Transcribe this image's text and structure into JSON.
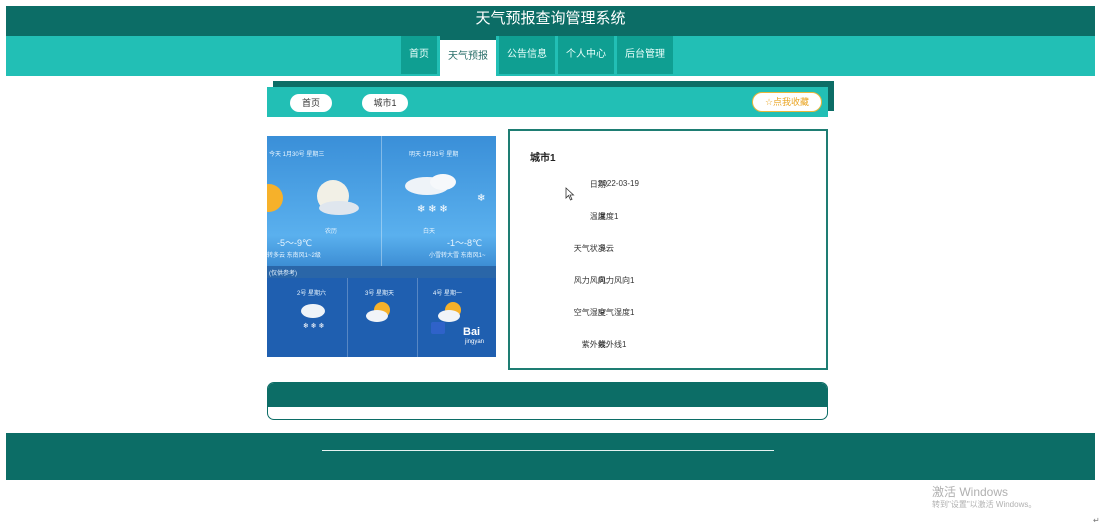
{
  "header": {
    "title": "天气预报查询管理系统",
    "nav": [
      {
        "label": "首页",
        "active": false
      },
      {
        "label": "天气预报",
        "active": true
      },
      {
        "label": "公告信息",
        "active": false
      },
      {
        "label": "个人中心",
        "active": false
      },
      {
        "label": "后台管理",
        "active": false
      }
    ]
  },
  "breadcrumb": {
    "home": "首页",
    "current": "城市1",
    "favorite": "☆点我收藏"
  },
  "weather_image": {
    "left_top": "今天 1月30号 星期三",
    "right_top": "明天 1月31号 星期",
    "left_cond": "农历",
    "right_cond": "白天",
    "left_temp": "-5～-9℃",
    "right_temp": "-1～-8℃",
    "left_wind": "转多云  东南风1~2级",
    "right_wind": "小雪转大雪  东南风1~",
    "band": "(仅供参考)",
    "d1": "2号 星期六",
    "d2": "3号 星期天",
    "d3": "4号 星期一",
    "watermark": "Bai",
    "watermark2": "jingyan"
  },
  "detail": {
    "city": "城市1",
    "fields": [
      {
        "label": "日期:",
        "value": "2022-03-19"
      },
      {
        "label": "温度:",
        "value": "温度1"
      },
      {
        "label": "天气状况:",
        "value": "多云"
      },
      {
        "label": "风力风向:",
        "value": "风力风向1"
      },
      {
        "label": "空气湿度:",
        "value": "空气湿度1"
      },
      {
        "label": "紫外线:",
        "value": "紫外线1"
      }
    ]
  },
  "os": {
    "activate_title": "激活 Windows",
    "activate_sub": "转到\"设置\"以激活 Windows。",
    "corner_mark": "↵"
  },
  "colors": {
    "dark_teal": "#0c6d66",
    "teal": "#22bfb5",
    "nav_item": "#0f9f92",
    "favorite": "#e9a423"
  }
}
